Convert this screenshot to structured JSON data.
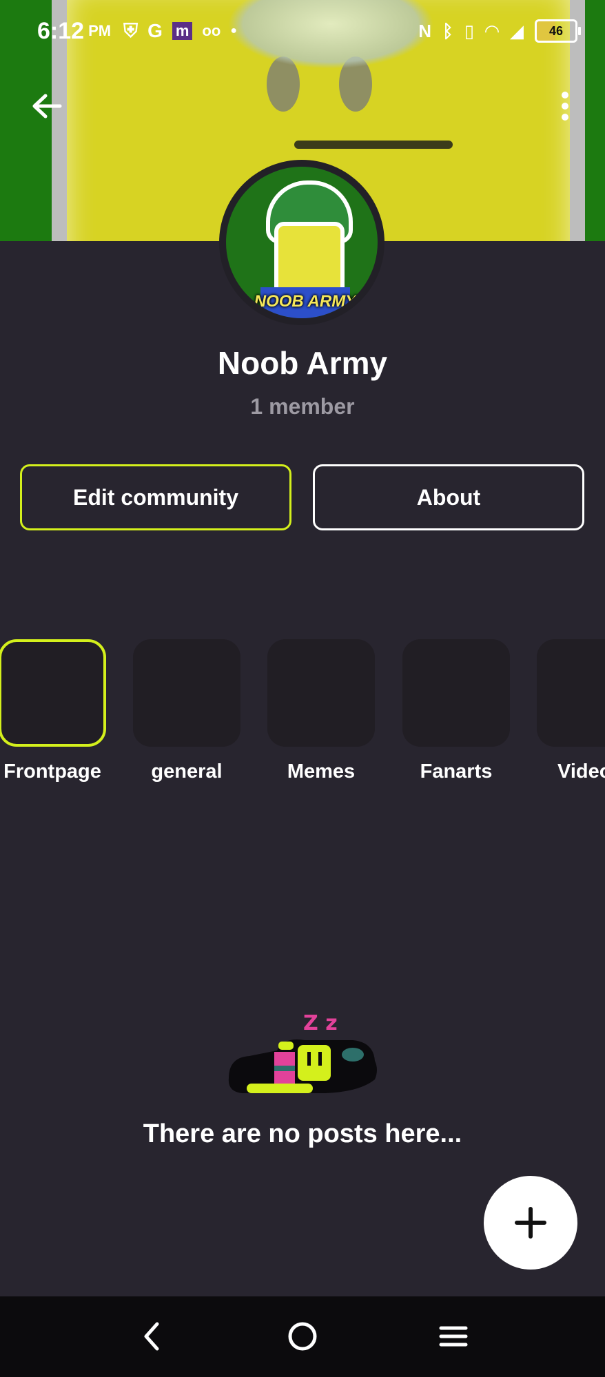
{
  "status_bar": {
    "time": "6:12",
    "ampm": "PM",
    "battery": "46",
    "icons": [
      "shield-icon",
      "google-icon",
      "app-m-icon",
      "voicemail-icon",
      "dot-icon",
      "nfc-icon",
      "bluetooth-icon",
      "vibrate-icon",
      "wifi-icon",
      "signal-icon",
      "battery-icon"
    ]
  },
  "header": {
    "back_icon": "arrow-left-icon",
    "more_icon": "more-vertical-icon"
  },
  "community": {
    "name": "Noob Army",
    "members": "1 member",
    "avatar_tag": "NOOB ARMY"
  },
  "actions": {
    "edit_label": "Edit community",
    "about_label": "About"
  },
  "channels": [
    {
      "label": "Frontpage",
      "active": true
    },
    {
      "label": "general",
      "active": false
    },
    {
      "label": "Memes",
      "active": false
    },
    {
      "label": "Fanarts",
      "active": false
    },
    {
      "label": "Videos",
      "active": false
    }
  ],
  "empty_state": {
    "message": "There are no posts here...",
    "sleep_text": "Z z"
  },
  "colors": {
    "background": "#28252f",
    "accent": "#d4f01c",
    "tile": "#211e24",
    "muted": "#9d9aa3"
  },
  "nav": [
    "back-nav-icon",
    "home-nav-icon",
    "menu-nav-icon"
  ]
}
